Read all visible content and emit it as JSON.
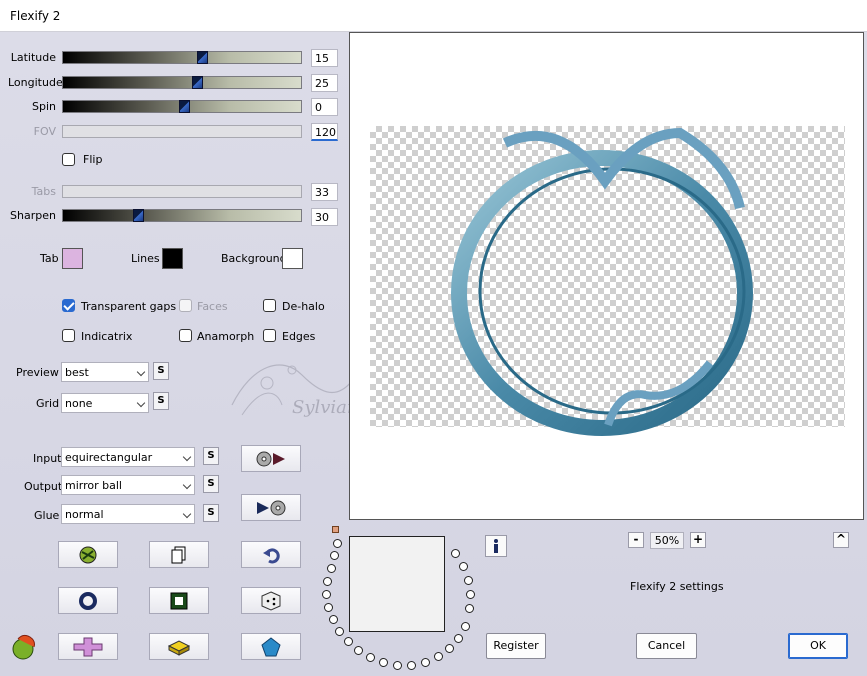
{
  "window": {
    "title": "Flexify 2"
  },
  "sliders": {
    "latitude": {
      "label": "Latitude",
      "value": "15",
      "fraction": 0.59
    },
    "longitude": {
      "label": "Longitude",
      "value": "25",
      "fraction": 0.57
    },
    "spin": {
      "label": "Spin",
      "value": "0",
      "fraction": 0.51
    },
    "fov": {
      "label": "FOV",
      "value": "120",
      "fraction": 0.0
    },
    "tabs": {
      "label": "Tabs",
      "value": "33",
      "fraction": 0.0
    },
    "sharpen": {
      "label": "Sharpen",
      "value": "30",
      "fraction": 0.31
    }
  },
  "flip": {
    "label": "Flip"
  },
  "colors": {
    "tab": {
      "label": "Tab",
      "color": "#dcb4e0"
    },
    "lines": {
      "label": "Lines",
      "color": "#000000"
    },
    "background": {
      "label": "Background",
      "color": "#ffffff"
    }
  },
  "options": {
    "transparent_gaps": "Transparent gaps",
    "faces": "Faces",
    "de_halo": "De-halo",
    "indicatrix": "Indicatrix",
    "anamorph": "Anamorph",
    "edges": "Edges"
  },
  "preview": {
    "label": "Preview",
    "value": "best"
  },
  "grid": {
    "label": "Grid",
    "value": "none"
  },
  "input": {
    "label": "Input",
    "value": "equirectangular"
  },
  "output": {
    "label": "Output",
    "value": "mirror ball"
  },
  "glue": {
    "label": "Glue",
    "value": "normal"
  },
  "s_label": "S",
  "zoom": {
    "minus": "-",
    "value": "50%",
    "plus": "+"
  },
  "caret_up": "^",
  "settings_title": "Flexify 2 settings",
  "buttons": {
    "register": "Register",
    "cancel": "Cancel",
    "ok": "OK"
  },
  "watermark_text": "Sylviane"
}
